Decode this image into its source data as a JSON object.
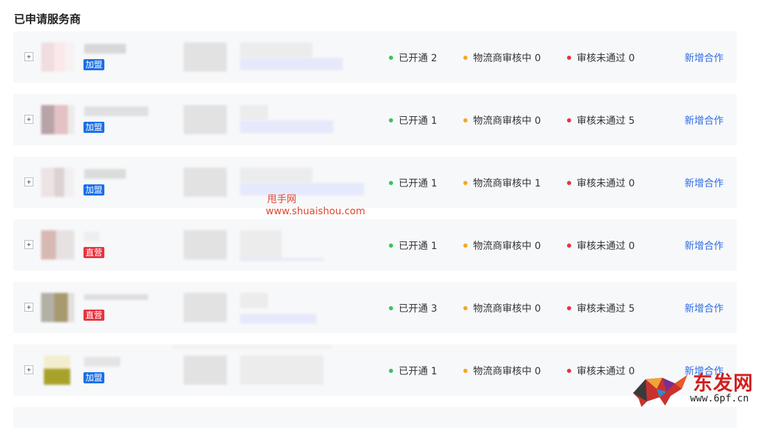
{
  "section": {
    "title": "已申请服务商"
  },
  "labels": {
    "opened_prefix": "已开通",
    "review_prefix": "物流商审核中",
    "failed_prefix": "审核未通过",
    "add_action": "新增合作"
  },
  "colors": {
    "dot_green": "#3cc35b",
    "dot_orange": "#f5a623",
    "dot_red": "#e8343f",
    "link_blue": "#2f6ce5",
    "tag_blue": "#1a6fe8",
    "tag_red": "#e8343f"
  },
  "providers": [
    {
      "tag": "加盟",
      "tag_type": "blue",
      "opened": "已开通 2",
      "review": "物流商审核中 0",
      "failed": "审核未通过 0",
      "action": "新增合作",
      "avatar_colors": [
        "#f1dde0",
        "#fbe8ea"
      ]
    },
    {
      "tag": "加盟",
      "tag_type": "blue",
      "opened": "已开通 1",
      "review": "物流商审核中 0",
      "failed": "审核未通过 5",
      "action": "新增合作",
      "avatar_colors": [
        "#b8a4a8",
        "#e4c1c4"
      ]
    },
    {
      "tag": "加盟",
      "tag_type": "blue",
      "opened": "已开通 1",
      "review": "物流商审核中 1",
      "failed": "审核未通过 0",
      "action": "新增合作",
      "avatar_colors": [
        "#ece3e4",
        "#dcd2d3"
      ]
    },
    {
      "tag": "直营",
      "tag_type": "red",
      "opened": "已开通 1",
      "review": "物流商审核中 0",
      "failed": "审核未通过 0",
      "action": "新增合作",
      "avatar_colors": [
        "#d8b8b2",
        "#e6e2e2"
      ]
    },
    {
      "tag": "直营",
      "tag_type": "red",
      "opened": "已开通 3",
      "review": "物流商审核中 0",
      "failed": "审核未通过 5",
      "action": "新增合作",
      "avatar_colors": [
        "#b3b0a6",
        "#a8996e"
      ]
    },
    {
      "tag": "加盟",
      "tag_type": "blue",
      "opened": "已开通 1",
      "review": "物流商审核中 0",
      "failed": "审核未通过 0",
      "action": "新增合作",
      "avatar_colors": [
        "#f4eed0",
        "#a9a22a"
      ]
    }
  ],
  "watermark": {
    "cn": "甩手网",
    "url": "www.shuaishou.com"
  },
  "logo": {
    "text": "东发网",
    "url": "www.6pf.cn"
  }
}
